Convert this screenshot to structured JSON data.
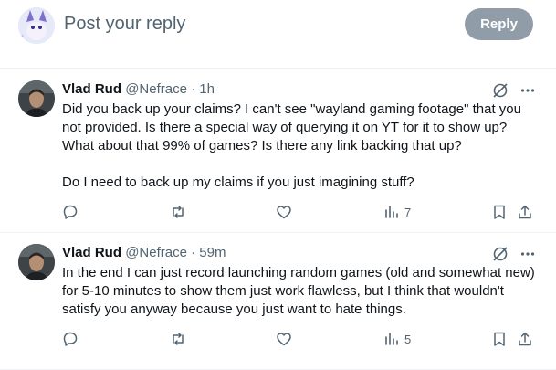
{
  "compose": {
    "placeholder": "Post your reply",
    "reply_label": "Reply"
  },
  "colors": {
    "text": "#0f1419",
    "secondary": "#536471",
    "reply_button": "#8b98a5",
    "border": "#eff3f4"
  },
  "tweets": [
    {
      "name": "Vlad Rud",
      "handle": "@Nefrace",
      "separator": "·",
      "time": "1h",
      "paragraphs": [
        "Did you back up your claims? I can't see \"wayland gaming footage\" that you not provided. Is there a special way of querying it on YT for it to show up? What about that 99% of games? Is there any link backing that up?",
        "Do I need to back up my claims if you just imagining stuff?"
      ],
      "views": "7",
      "icons": [
        "grok-icon",
        "more-icon",
        "reply-icon",
        "repost-icon",
        "like-icon",
        "views-icon",
        "bookmark-icon",
        "share-icon"
      ]
    },
    {
      "name": "Vlad Rud",
      "handle": "@Nefrace",
      "separator": "·",
      "time": "59m",
      "paragraphs": [
        "In the end I can just record launching random games (old and somewhat new) for 5-10 minutes to show them just work flawless, but I think that wouldn't satisfy you anyway because you just want to hate things."
      ],
      "views": "5",
      "icons": [
        "grok-icon",
        "more-icon",
        "reply-icon",
        "repost-icon",
        "like-icon",
        "views-icon",
        "bookmark-icon",
        "share-icon"
      ]
    }
  ]
}
